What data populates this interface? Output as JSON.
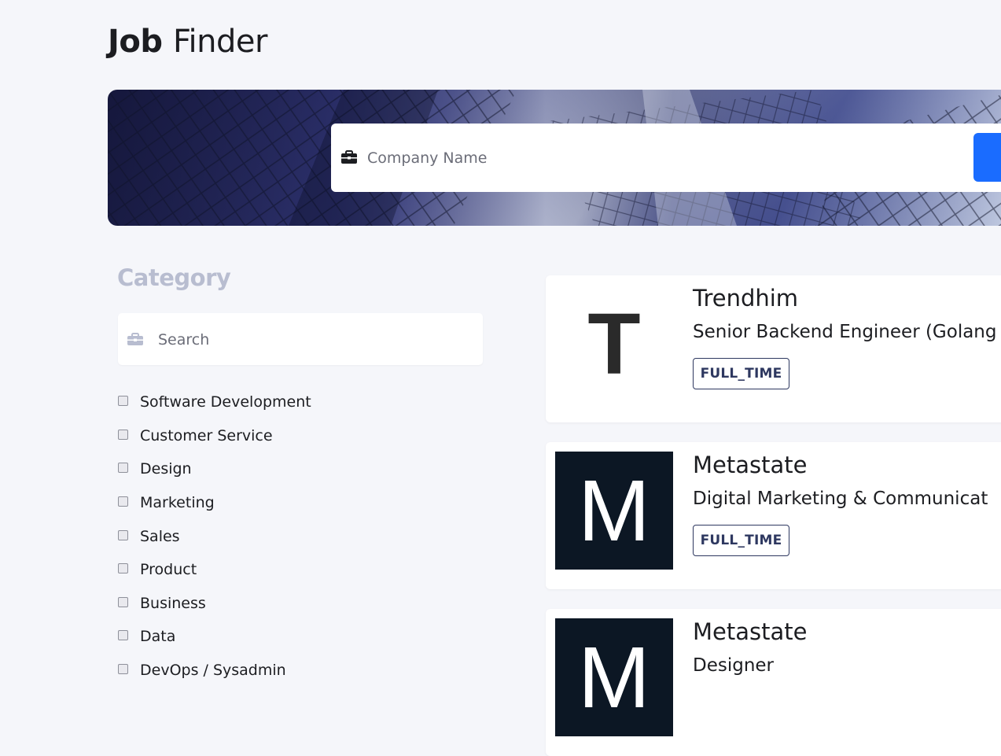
{
  "header": {
    "title_bold": "Job",
    "title_light": "Finder"
  },
  "hero": {
    "search_placeholder": "Company Name",
    "search_icon": "briefcase-icon"
  },
  "sidebar": {
    "title": "Category",
    "search_placeholder": "Search",
    "search_icon": "briefcase-icon",
    "categories": [
      {
        "label": "Software Development",
        "checked": false
      },
      {
        "label": "Customer Service",
        "checked": false
      },
      {
        "label": "Design",
        "checked": false
      },
      {
        "label": "Marketing",
        "checked": false
      },
      {
        "label": "Sales",
        "checked": false
      },
      {
        "label": "Product",
        "checked": false
      },
      {
        "label": "Business",
        "checked": false
      },
      {
        "label": "Data",
        "checked": false
      },
      {
        "label": "DevOps / Sysadmin",
        "checked": false
      }
    ]
  },
  "jobs": [
    {
      "logo_letter": "T",
      "company": "Trendhim",
      "position": "Senior Backend Engineer (Golang",
      "type": "FULL_TIME"
    },
    {
      "logo_letter": "M",
      "company": "Metastate",
      "position": "Digital Marketing & Communicat",
      "type": "FULL_TIME"
    },
    {
      "logo_letter": "M",
      "company": "Metastate",
      "position": "Designer",
      "type": ""
    }
  ],
  "colors": {
    "background": "#f5f6fa",
    "accent": "#1a6cff",
    "badge": "#2e3860",
    "category_title": "#b8bdd0",
    "dark_logo": "#0c1724"
  }
}
